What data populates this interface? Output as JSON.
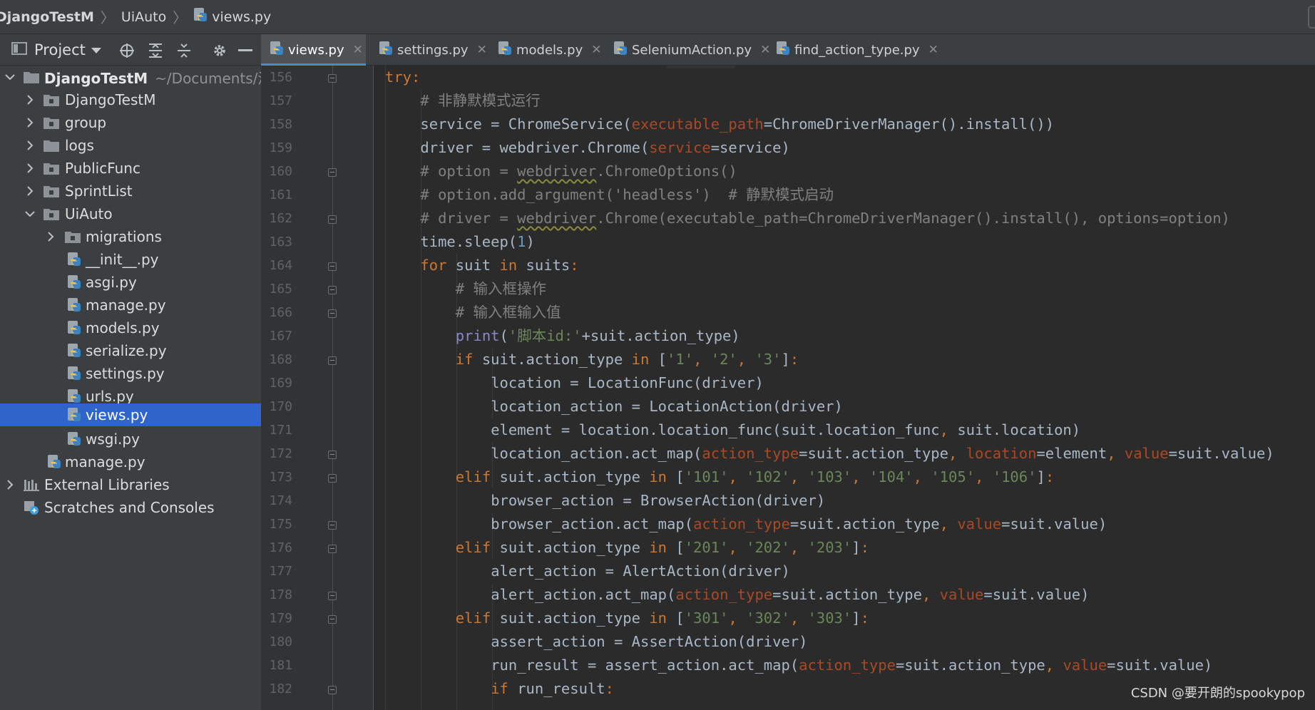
{
  "breadcrumb": {
    "items": [
      "DjangoTestM",
      "UiAuto",
      "views.py"
    ]
  },
  "project_panel": {
    "title": "Project"
  },
  "tabs": [
    {
      "label": "views.py",
      "active": true
    },
    {
      "label": "settings.py",
      "active": false
    },
    {
      "label": "models.py",
      "active": false
    },
    {
      "label": "SeleniumAction.py",
      "active": false
    },
    {
      "label": "find_action_type.py",
      "active": false
    }
  ],
  "tree": {
    "root_label": "DjangoTestM",
    "root_path": "~/Documents/源",
    "items": [
      {
        "label": "DjangoTestM",
        "type": "folder",
        "expanded": false
      },
      {
        "label": "group",
        "type": "folder",
        "expanded": false
      },
      {
        "label": "logs",
        "type": "folder",
        "expanded": false
      },
      {
        "label": "PublicFunc",
        "type": "folder",
        "expanded": false
      },
      {
        "label": "SprintList",
        "type": "folder",
        "expanded": false
      },
      {
        "label": "UiAuto",
        "type": "folder",
        "expanded": true
      },
      {
        "label": "migrations",
        "type": "folder",
        "expanded": false
      },
      {
        "label": "__init__.py",
        "type": "python"
      },
      {
        "label": "asgi.py",
        "type": "python"
      },
      {
        "label": "manage.py",
        "type": "python"
      },
      {
        "label": "models.py",
        "type": "python"
      },
      {
        "label": "serialize.py",
        "type": "python"
      },
      {
        "label": "settings.py",
        "type": "python"
      },
      {
        "label": "urls.py",
        "type": "python"
      },
      {
        "label": "views.py",
        "type": "python",
        "selected": true
      },
      {
        "label": "wsgi.py",
        "type": "python"
      },
      {
        "label": "manage.py",
        "type": "python"
      },
      {
        "label": "External Libraries",
        "type": "libraries"
      },
      {
        "label": "Scratches and Consoles",
        "type": "scratches"
      }
    ]
  },
  "editor": {
    "line_numbers": [
      "156",
      "157",
      "158",
      "159",
      "160",
      "161",
      "162",
      "163",
      "164",
      "165",
      "166",
      "167",
      "168",
      "169",
      "170",
      "171",
      "172",
      "173",
      "174",
      "175",
      "176",
      "177",
      "178",
      "179",
      "180",
      "181",
      "182"
    ],
    "lines": [
      "try:",
      "# 非静默模式运行",
      "service = ChromeService(executable_path=ChromeDriverManager().install())",
      "driver = webdriver.Chrome(service=service)",
      "# option = webdriver.ChromeOptions()",
      "# option.add_argument('headless')  # 静默模式启动",
      "# driver = webdriver.Chrome(executable_path=ChromeDriverManager().install(), options=option)",
      "time.sleep(1)",
      "for suit in suits:",
      "# 输入框操作",
      "# 输入框输入值",
      "print('脚本id:'+suit.action_type)",
      "if suit.action_type in ['1', '2', '3']:",
      "location = LocationFunc(driver)",
      "location_action = LocationAction(driver)",
      "element = location.location_func(suit.location_func, suit.location)",
      "location_action.act_map(action_type=suit.action_type, location=element, value=suit.value)",
      "elif suit.action_type in ['101', '102', '103', '104', '105', '106']:",
      "browser_action = BrowserAction(driver)",
      "browser_action.act_map(action_type=suit.action_type, value=suit.value)",
      "elif suit.action_type in ['201', '202', '203']:",
      "alert_action = AlertAction(driver)",
      "alert_action.act_map(action_type=suit.action_type, value=suit.value)",
      "elif suit.action_type in ['301', '302', '303']:",
      "assert_action = AssertAction(driver)",
      "run_result = assert_action.act_map(action_type=suit.action_type, value=suit.value)",
      "if run_result:"
    ]
  },
  "watermark": "CSDN @要开朗的spookypop",
  "colors": {
    "keyword": "#cc7832",
    "param": "#aa4926",
    "comment": "#808080",
    "string": "#6a8759",
    "number": "#6897bb",
    "builtin": "#8888c6",
    "default_text": "#a9b7c6",
    "selection": "#2f65ca",
    "tab_underline": "#4a88c7"
  }
}
